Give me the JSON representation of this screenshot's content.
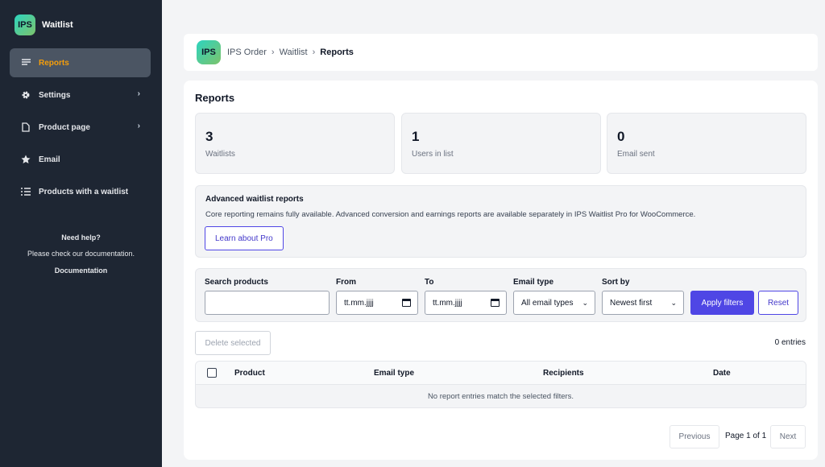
{
  "sidebar": {
    "logo": "IPS",
    "title": "Waitlist",
    "items": [
      {
        "label": "Reports",
        "icon": "lines-icon",
        "active": true,
        "chevron": false
      },
      {
        "label": "Settings",
        "icon": "gear-icon",
        "active": false,
        "chevron": true
      },
      {
        "label": "Product page",
        "icon": "page-icon",
        "active": false,
        "chevron": true
      },
      {
        "label": "Email",
        "icon": "star-icon",
        "active": false,
        "chevron": false
      },
      {
        "label": "Products with a waitlist",
        "icon": "list-icon",
        "active": false,
        "chevron": false
      }
    ],
    "help": {
      "title": "Need help?",
      "text": "Please check our documentation.",
      "link": "Documentation"
    }
  },
  "breadcrumb": {
    "logo": "IPS",
    "items": [
      "IPS Order",
      "Waitlist",
      "Reports"
    ],
    "separator": "›"
  },
  "main": {
    "title": "Reports",
    "stats": [
      {
        "value": "3",
        "label": "Waitlists"
      },
      {
        "value": "1",
        "label": "Users in list"
      },
      {
        "value": "0",
        "label": "Email sent"
      }
    ],
    "promo": {
      "title": "Advanced waitlist reports",
      "text": "Core reporting remains fully available. Advanced conversion and earnings reports are available separately in IPS Waitlist Pro for WooCommerce.",
      "button": "Learn about Pro"
    },
    "filters": {
      "search_label": "Search products",
      "search_value": "",
      "from_label": "From",
      "from_value": "tt.mm.jjjj",
      "to_label": "To",
      "to_value": "tt.mm.jjjj",
      "email_type_label": "Email type",
      "email_type_value": "All email types",
      "sort_label": "Sort by",
      "sort_value": "Newest first",
      "apply": "Apply filters",
      "reset": "Reset"
    },
    "delete_selected": "Delete selected",
    "entries": "0 entries",
    "table": {
      "columns": [
        "Product",
        "Email type",
        "Recipients",
        "Date"
      ],
      "empty": "No report entries match the selected filters."
    },
    "pagination": {
      "previous": "Previous",
      "info": "Page 1 of 1",
      "next": "Next"
    }
  },
  "colors": {
    "sidebar_bg": "#1e2633",
    "active_item_text": "#f59e0b",
    "primary": "#4f46e5"
  }
}
